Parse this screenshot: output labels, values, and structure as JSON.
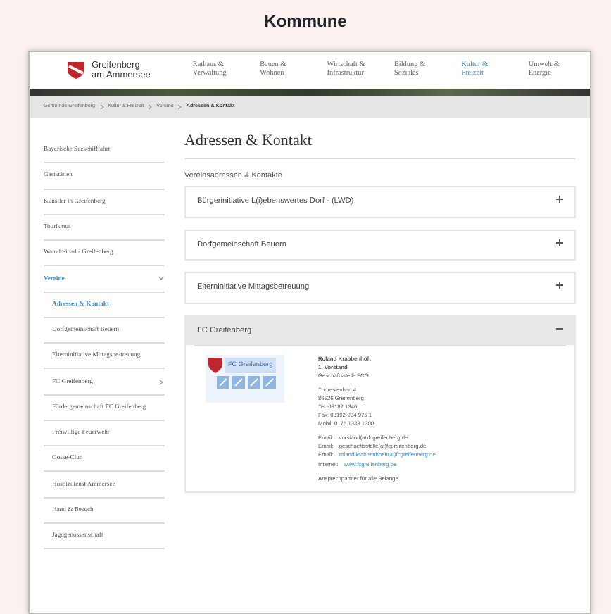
{
  "page_title": "Kommune",
  "site": {
    "logo_line1": "Greifenberg",
    "logo_line2": "am Ammersee"
  },
  "nav": [
    {
      "label": "Rathaus & Verwaltung",
      "selected": false
    },
    {
      "label": "Bauen & Wohnen",
      "selected": false
    },
    {
      "label": "Wirtschaft & Infrastruktur",
      "selected": false
    },
    {
      "label": "Bildung & Soziales",
      "selected": false
    },
    {
      "label": "Kultur & Freizeit",
      "selected": true
    },
    {
      "label": "Umwelt & Energie",
      "selected": false
    }
  ],
  "breadcrumb": [
    "Gemeinde Greifenberg",
    "Kultur & Freizeit",
    "Vereine",
    "Adressen & Kontakt"
  ],
  "sidebar": [
    {
      "label": "Bayerische Seeschifffahrt",
      "selected": false
    },
    {
      "label": "Gaststätten",
      "selected": false
    },
    {
      "label": "Künstler in Greifenberg",
      "selected": false
    },
    {
      "label": "Tourismus",
      "selected": false
    },
    {
      "label": "Wamdreibad - Greifenberg",
      "selected": false
    },
    {
      "label": "Vereine",
      "selected": true,
      "expanded": true,
      "children": [
        {
          "label": "Adressen & Kontakt",
          "selected": true
        },
        {
          "label": "Dorfgemeinschaft Beuern",
          "selected": false
        },
        {
          "label": "Elterninitiative Mittagsbe-treuung",
          "selected": false
        },
        {
          "label": "FC Greifenberg",
          "selected": false,
          "expanded": false
        },
        {
          "label": "Fördergemeinschaft FC Greifenberg",
          "selected": false
        },
        {
          "label": "Freiwillige Feuerwehr",
          "selected": false
        },
        {
          "label": "Gosse-Club",
          "selected": false
        },
        {
          "label": "Hospizdienst Ammersee",
          "selected": false
        },
        {
          "label": "Hand & Besuch",
          "selected": false
        },
        {
          "label": "Jagdgenossenschaft",
          "selected": false
        }
      ]
    }
  ],
  "heading": "Adressen & Kontakt",
  "subheading": "Vereinsadressen & Kontakte",
  "accordion": [
    {
      "title": "Bürgerinitiative L(i)ebenswertes Dorf - (LWD)",
      "expanded": false
    },
    {
      "title": "Dorfgemeinschaft Beuern",
      "expanded": false
    },
    {
      "title": "Elterninitiative Mittagsbetreuung",
      "expanded": false
    },
    {
      "title": "FC Greifenberg",
      "expanded": true,
      "logo_text": "FC Greifenberg",
      "contact_name": "Roland Krabbenhöft",
      "role": "1. Vorstand",
      "office": "Geschäftsstelle FCG",
      "address": [
        "Thoresienbad 4",
        "86926 Greifenberg",
        "Tel: 08192 1346",
        "Fax: 08192-994 975 1",
        "Mobil: 0176 1333 1300"
      ],
      "emails": [
        {
          "label": "Email:",
          "value": "vorstand(at)fcgreifenberg.de",
          "link": false
        },
        {
          "label": "Email:",
          "value": "geschaeftsstelle(at)fcgreifenberg.de",
          "link": false
        },
        {
          "label": "Email:",
          "value": "roland.krabbenhoeft(at)fcgreifenberg.de",
          "link": true
        },
        {
          "label": "Internet:",
          "value": "www.fcgreifenberg.de",
          "link": true
        }
      ],
      "note": "Ansprechpartner für alle Belange"
    }
  ]
}
